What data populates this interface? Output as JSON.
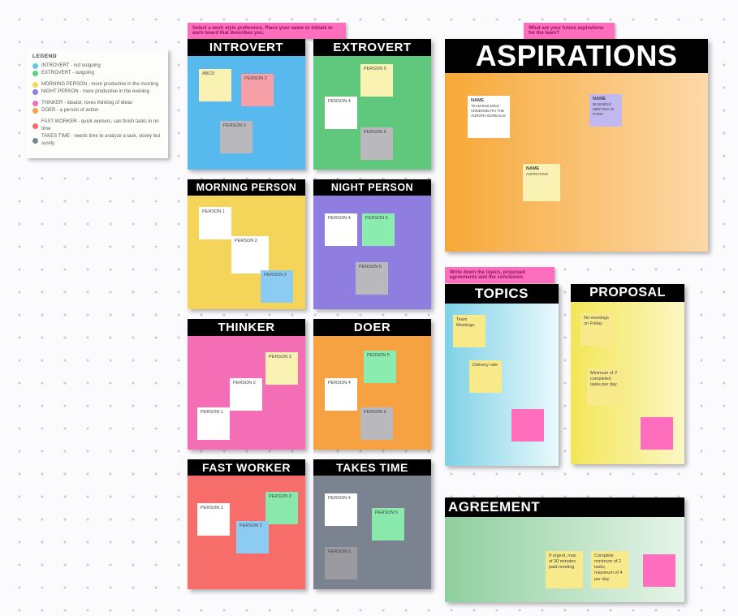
{
  "legend": {
    "title": "LEGEND",
    "rows": [
      {
        "color": "#63c7f2",
        "text": "INTROVERT - not outgoing"
      },
      {
        "color": "#64cd84",
        "text": "EXTROVERT - outgoing"
      },
      {
        "color": "#f6d957",
        "text": "MORNING PERSON - more productive in the morning"
      },
      {
        "color": "#8f7ee0",
        "text": "NIGHT PERSON - more productive in the evening"
      },
      {
        "color": "#f36eb5",
        "text": "THINKER - ideator, loves thinking of ideas"
      },
      {
        "color": "#f6a243",
        "text": "DOER - a person of action"
      },
      {
        "color": "#f76d6a",
        "text": "FAST WORKER - quick workers, can finish tasks in no time"
      },
      {
        "color": "#7b8290",
        "text": "TAKES TIME - needs time to analyze a task, slowly but surely"
      }
    ]
  },
  "instructions": {
    "prefs": "Select a work style preference. Place your name or initials to each board that describes you.",
    "aspirations": "What are your future aspirations for the team?",
    "agreement": "Write down the topics, proposed agreements and the conclusion"
  },
  "boards": {
    "introvert": {
      "title": "INTROVERT",
      "notes": {
        "abcd": "ABCD",
        "p2": "PERSON 2",
        "p3": "PERSON 3"
      }
    },
    "extrovert": {
      "title": "EXTROVERT",
      "notes": {
        "p5": "PERSON 5",
        "p4": "PERSON 4",
        "p6": "PERSON 6"
      }
    },
    "morning": {
      "title": "MORNING PERSON",
      "notes": {
        "p1": "PERSON 1",
        "p2": "PERSON 2",
        "p3": "PERSON 3"
      }
    },
    "night": {
      "title": "NIGHT PERSON",
      "notes": {
        "p4": "PERSON 4",
        "p5": "PERSON 5",
        "p6": "PERSON 6"
      }
    },
    "thinker": {
      "title": "THINKER",
      "notes": {
        "p1": "PERSON 1",
        "p2": "PERSON 2",
        "p3": "PERSON 3"
      }
    },
    "doer": {
      "title": "DOER",
      "notes": {
        "p4": "PERSON 4",
        "p5": "PERSON 5",
        "p6": "PERSON 6"
      }
    },
    "fast": {
      "title": "FAST WORKER",
      "notes": {
        "p1": "PERSON 1",
        "p2": "PERSON 2",
        "p3": "PERSON 3"
      }
    },
    "takes": {
      "title": "TAKES TIME",
      "notes": {
        "p4": "PERSON 4",
        "p5": "PERSON 5",
        "p6": "PERSON 6"
      }
    },
    "aspirations": {
      "title": "ASPIRATIONS",
      "n1_name": "NAME",
      "n1_body": "TEAM BUILDING UNDERNEATH THE AURORA BOREALIS",
      "n2_name": "NAME",
      "n2_body": "BUSINESS MEETING IN PARIS",
      "n3_name": "NAME",
      "n3_body": "ASPIRATION"
    },
    "topics": {
      "title": "TOPICS",
      "n1": "Team Meetings",
      "n2": "Delivery rate"
    },
    "proposal": {
      "title": "PROPOSAL",
      "n1": "No meetings on Friday",
      "n2": "Minimum of 2 completed tasks per day"
    },
    "agreement": {
      "title": "AGREEMENT",
      "n1": "If urgent, max of 30 minutes paid meeting",
      "n2": "Complete minimum of 2 tasks, maximum of 4 per day"
    }
  }
}
